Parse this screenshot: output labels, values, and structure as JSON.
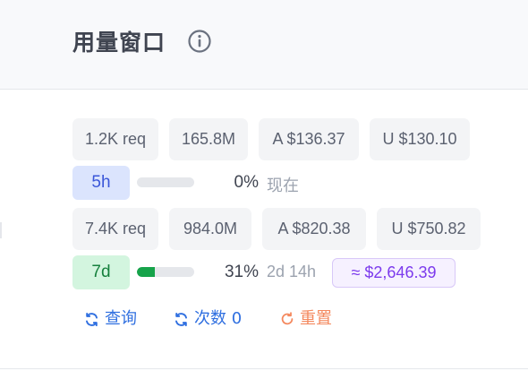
{
  "header": {
    "title": "用量窗口",
    "info_icon": "info-icon"
  },
  "windows": [
    {
      "label": "5h",
      "stats": {
        "requests": "1.2K req",
        "tokens": "165.8M",
        "a_cost": "A $136.37",
        "u_cost": "U $130.10"
      },
      "progress": 0,
      "percent_text": "0%",
      "reset_text": "现在",
      "color": "#3b57d9"
    },
    {
      "label": "7d",
      "stats": {
        "requests": "7.4K req",
        "tokens": "984.0M",
        "a_cost": "A $820.38",
        "u_cost": "U $750.82"
      },
      "progress": 0.31,
      "percent_text": "31%",
      "reset_text": "2d 14h",
      "cost_badge": "≈ $2,646.39",
      "color": "#16a34a"
    }
  ],
  "actions": {
    "query": "查询",
    "count": "次数 0",
    "reset": "重置"
  },
  "colors": {
    "accent_blue": "#2f6fe0",
    "reset_orange": "#f4895f",
    "badge_purple": "#7c3aed"
  }
}
